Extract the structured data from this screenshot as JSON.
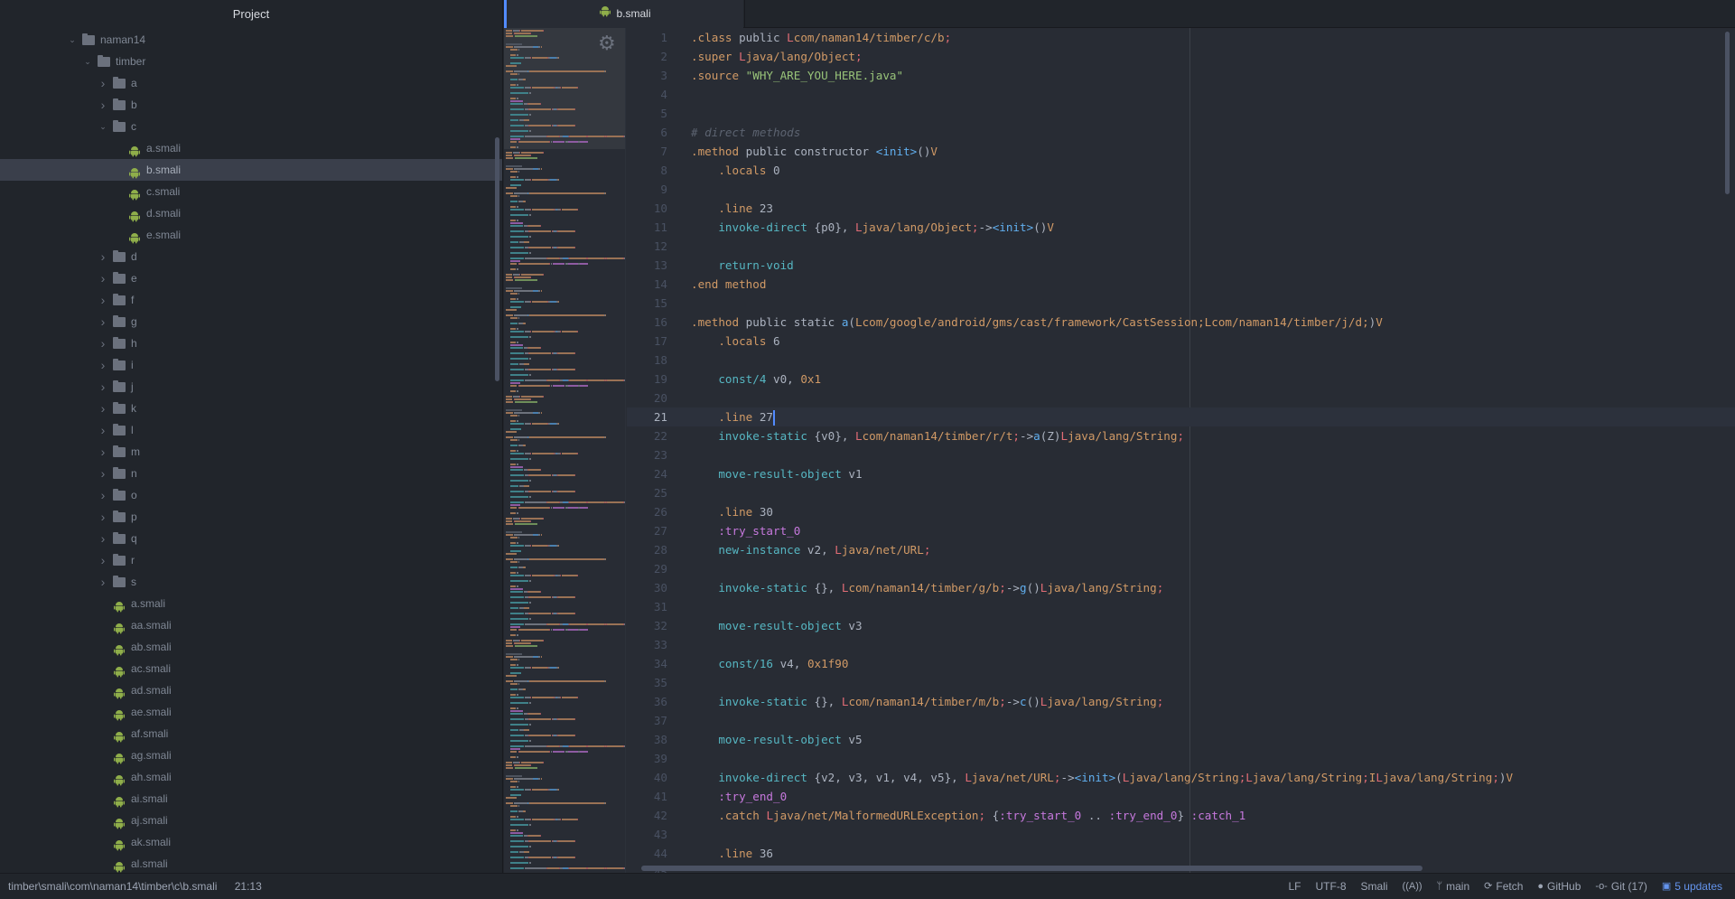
{
  "tree": {
    "header": "Project",
    "selected_file": "b.smali",
    "items": [
      {
        "label": "naman14",
        "type": "folder",
        "expanded": true,
        "depth": 0
      },
      {
        "label": "timber",
        "type": "folder",
        "expanded": true,
        "depth": 1
      },
      {
        "label": "a",
        "type": "folder",
        "expanded": false,
        "depth": 2
      },
      {
        "label": "b",
        "type": "folder",
        "expanded": false,
        "depth": 2
      },
      {
        "label": "c",
        "type": "folder",
        "expanded": true,
        "depth": 2
      },
      {
        "label": "a.smali",
        "type": "file",
        "depth": 3
      },
      {
        "label": "b.smali",
        "type": "file",
        "depth": 3,
        "selected": true
      },
      {
        "label": "c.smali",
        "type": "file",
        "depth": 3
      },
      {
        "label": "d.smali",
        "type": "file",
        "depth": 3
      },
      {
        "label": "e.smali",
        "type": "file",
        "depth": 3
      },
      {
        "label": "d",
        "type": "folder",
        "expanded": false,
        "depth": 2
      },
      {
        "label": "e",
        "type": "folder",
        "expanded": false,
        "depth": 2
      },
      {
        "label": "f",
        "type": "folder",
        "expanded": false,
        "depth": 2
      },
      {
        "label": "g",
        "type": "folder",
        "expanded": false,
        "depth": 2
      },
      {
        "label": "h",
        "type": "folder",
        "expanded": false,
        "depth": 2
      },
      {
        "label": "i",
        "type": "folder",
        "expanded": false,
        "depth": 2
      },
      {
        "label": "j",
        "type": "folder",
        "expanded": false,
        "depth": 2
      },
      {
        "label": "k",
        "type": "folder",
        "expanded": false,
        "depth": 2
      },
      {
        "label": "l",
        "type": "folder",
        "expanded": false,
        "depth": 2
      },
      {
        "label": "m",
        "type": "folder",
        "expanded": false,
        "depth": 2
      },
      {
        "label": "n",
        "type": "folder",
        "expanded": false,
        "depth": 2
      },
      {
        "label": "o",
        "type": "folder",
        "expanded": false,
        "depth": 2
      },
      {
        "label": "p",
        "type": "folder",
        "expanded": false,
        "depth": 2
      },
      {
        "label": "q",
        "type": "folder",
        "expanded": false,
        "depth": 2
      },
      {
        "label": "r",
        "type": "folder",
        "expanded": false,
        "depth": 2
      },
      {
        "label": "s",
        "type": "folder",
        "expanded": false,
        "depth": 2
      },
      {
        "label": "a.smali",
        "type": "file",
        "depth": 2
      },
      {
        "label": "aa.smali",
        "type": "file",
        "depth": 2
      },
      {
        "label": "ab.smali",
        "type": "file",
        "depth": 2
      },
      {
        "label": "ac.smali",
        "type": "file",
        "depth": 2
      },
      {
        "label": "ad.smali",
        "type": "file",
        "depth": 2
      },
      {
        "label": "ae.smali",
        "type": "file",
        "depth": 2
      },
      {
        "label": "af.smali",
        "type": "file",
        "depth": 2
      },
      {
        "label": "ag.smali",
        "type": "file",
        "depth": 2
      },
      {
        "label": "ah.smali",
        "type": "file",
        "depth": 2
      },
      {
        "label": "ai.smali",
        "type": "file",
        "depth": 2
      },
      {
        "label": "aj.smali",
        "type": "file",
        "depth": 2
      },
      {
        "label": "ak.smali",
        "type": "file",
        "depth": 2
      },
      {
        "label": "al.smali",
        "type": "file",
        "depth": 2
      }
    ]
  },
  "editor": {
    "tab": {
      "label": "b.smali",
      "icon": "android-icon"
    },
    "cursor_line": 21,
    "lines": [
      [
        [
          "kw",
          ".class"
        ],
        [
          "pl",
          " public "
        ],
        [
          "L",
          "L"
        ],
        [
          "ty",
          "com/naman14/timber/c/b"
        ],
        [
          "sep",
          ";"
        ]
      ],
      [
        [
          "kw",
          ".super"
        ],
        [
          "pl",
          " "
        ],
        [
          "L",
          "L"
        ],
        [
          "ty",
          "java/lang/Object"
        ],
        [
          "sep",
          ";"
        ]
      ],
      [
        [
          "kw",
          ".source"
        ],
        [
          "pl",
          " "
        ],
        [
          "str",
          "\"WHY_ARE_YOU_HERE.java\""
        ]
      ],
      [],
      [],
      [
        [
          "cm",
          "# direct methods"
        ]
      ],
      [
        [
          "kw",
          ".method"
        ],
        [
          "pl",
          " public constructor "
        ],
        [
          "fn",
          "<init>"
        ],
        [
          "pl",
          "()"
        ],
        [
          "ty",
          "V"
        ]
      ],
      [
        [
          "pl",
          "    "
        ],
        [
          "kw",
          ".locals"
        ],
        [
          "pl",
          " 0"
        ]
      ],
      [],
      [
        [
          "pl",
          "    "
        ],
        [
          "kw",
          ".line"
        ],
        [
          "pl",
          " 23"
        ]
      ],
      [
        [
          "pl",
          "    "
        ],
        [
          "ins",
          "invoke-direct"
        ],
        [
          "pl",
          " {p0}, "
        ],
        [
          "L",
          "L"
        ],
        [
          "ty",
          "java/lang/Object"
        ],
        [
          "sep",
          ";"
        ],
        [
          "pl",
          "->"
        ],
        [
          "fn",
          "<init>"
        ],
        [
          "pl",
          "()"
        ],
        [
          "ty",
          "V"
        ]
      ],
      [],
      [
        [
          "pl",
          "    "
        ],
        [
          "ins",
          "return-void"
        ]
      ],
      [
        [
          "kw",
          ".end method"
        ]
      ],
      [],
      [
        [
          "kw",
          ".method"
        ],
        [
          "pl",
          " public static "
        ],
        [
          "fn",
          "a"
        ],
        [
          "pl",
          "("
        ],
        [
          "ty",
          "Lcom/google/android/gms/cast/framework/CastSession;Lcom/naman14/timber/j/d;"
        ],
        [
          "pl",
          ")"
        ],
        [
          "ty",
          "V"
        ]
      ],
      [
        [
          "pl",
          "    "
        ],
        [
          "kw",
          ".locals"
        ],
        [
          "pl",
          " 6"
        ]
      ],
      [],
      [
        [
          "pl",
          "    "
        ],
        [
          "ins",
          "const/4"
        ],
        [
          "pl",
          " v0, "
        ],
        [
          "num",
          "0x1"
        ]
      ],
      [],
      [
        [
          "pl",
          "    "
        ],
        [
          "kw",
          ".line"
        ],
        [
          "pl",
          " 27"
        ],
        [
          "caret",
          ""
        ]
      ],
      [
        [
          "pl",
          "    "
        ],
        [
          "ins",
          "invoke-static"
        ],
        [
          "pl",
          " {v0}, "
        ],
        [
          "L",
          "L"
        ],
        [
          "ty",
          "com/naman14/timber/r/t"
        ],
        [
          "sep",
          ";"
        ],
        [
          "pl",
          "->"
        ],
        [
          "fn",
          "a"
        ],
        [
          "pl",
          "(Z)"
        ],
        [
          "L",
          "L"
        ],
        [
          "ty",
          "java/lang/String"
        ],
        [
          "sep",
          ";"
        ]
      ],
      [],
      [
        [
          "pl",
          "    "
        ],
        [
          "ins",
          "move-result-object"
        ],
        [
          "pl",
          " v1"
        ]
      ],
      [],
      [
        [
          "pl",
          "    "
        ],
        [
          "kw",
          ".line"
        ],
        [
          "pl",
          " 30"
        ]
      ],
      [
        [
          "pl",
          "    "
        ],
        [
          "lbl",
          ":try_start_0"
        ]
      ],
      [
        [
          "pl",
          "    "
        ],
        [
          "ins",
          "new-instance"
        ],
        [
          "pl",
          " v2, "
        ],
        [
          "L",
          "L"
        ],
        [
          "ty",
          "java/net/URL"
        ],
        [
          "sep",
          ";"
        ]
      ],
      [],
      [
        [
          "pl",
          "    "
        ],
        [
          "ins",
          "invoke-static"
        ],
        [
          "pl",
          " {}, "
        ],
        [
          "L",
          "L"
        ],
        [
          "ty",
          "com/naman14/timber/g/b"
        ],
        [
          "sep",
          ";"
        ],
        [
          "pl",
          "->"
        ],
        [
          "fn",
          "g"
        ],
        [
          "pl",
          "()"
        ],
        [
          "L",
          "L"
        ],
        [
          "ty",
          "java/lang/String"
        ],
        [
          "sep",
          ";"
        ]
      ],
      [],
      [
        [
          "pl",
          "    "
        ],
        [
          "ins",
          "move-result-object"
        ],
        [
          "pl",
          " v3"
        ]
      ],
      [],
      [
        [
          "pl",
          "    "
        ],
        [
          "ins",
          "const/16"
        ],
        [
          "pl",
          " v4, "
        ],
        [
          "num",
          "0x1f90"
        ]
      ],
      [],
      [
        [
          "pl",
          "    "
        ],
        [
          "ins",
          "invoke-static"
        ],
        [
          "pl",
          " {}, "
        ],
        [
          "L",
          "L"
        ],
        [
          "ty",
          "com/naman14/timber/m/b"
        ],
        [
          "sep",
          ";"
        ],
        [
          "pl",
          "->"
        ],
        [
          "fn",
          "c"
        ],
        [
          "pl",
          "()"
        ],
        [
          "L",
          "L"
        ],
        [
          "ty",
          "java/lang/String"
        ],
        [
          "sep",
          ";"
        ]
      ],
      [],
      [
        [
          "pl",
          "    "
        ],
        [
          "ins",
          "move-result-object"
        ],
        [
          "pl",
          " v5"
        ]
      ],
      [],
      [
        [
          "pl",
          "    "
        ],
        [
          "ins",
          "invoke-direct"
        ],
        [
          "pl",
          " {v2, v3, v1, v4, v5}, "
        ],
        [
          "L",
          "L"
        ],
        [
          "ty",
          "java/net/URL"
        ],
        [
          "sep",
          ";"
        ],
        [
          "pl",
          "->"
        ],
        [
          "fn",
          "<init>"
        ],
        [
          "pl",
          "("
        ],
        [
          "L",
          "L"
        ],
        [
          "ty",
          "java/lang/String"
        ],
        [
          "sep",
          ";"
        ],
        [
          "L",
          "L"
        ],
        [
          "ty",
          "java/lang/String"
        ],
        [
          "sep",
          ";"
        ],
        [
          "ty",
          "I"
        ],
        [
          "L",
          "L"
        ],
        [
          "ty",
          "java/lang/String"
        ],
        [
          "sep",
          ";"
        ],
        [
          "pl",
          ")"
        ],
        [
          "ty",
          "V"
        ]
      ],
      [
        [
          "pl",
          "    "
        ],
        [
          "lbl",
          ":try_end_0"
        ]
      ],
      [
        [
          "pl",
          "    "
        ],
        [
          "kw",
          ".catch"
        ],
        [
          "pl",
          " "
        ],
        [
          "L",
          "L"
        ],
        [
          "ty",
          "java/net/MalformedURLException"
        ],
        [
          "sep",
          ";"
        ],
        [
          "pl",
          " {"
        ],
        [
          "lbl",
          ":try_start_0"
        ],
        [
          "pl",
          " .. "
        ],
        [
          "lbl",
          ":try_end_0"
        ],
        [
          "pl",
          "} "
        ],
        [
          "lbl",
          ":catch_1"
        ]
      ],
      [],
      [
        [
          "pl",
          "    "
        ],
        [
          "kw",
          ".line"
        ],
        [
          "pl",
          " 36"
        ]
      ],
      []
    ]
  },
  "status_bar": {
    "file_path": "timber\\smali\\com\\naman14\\timber\\c\\b.smali",
    "cursor_position": "21:13",
    "line_ending": "LF",
    "encoding": "UTF-8",
    "grammar": "Smali",
    "branch": "main",
    "fetch": "Fetch",
    "github": "GitHub",
    "git": "Git (17)",
    "updates": "5 updates"
  },
  "colors": {
    "accent": "#528bff",
    "android_green": "#8fae4a",
    "updates_blue": "#6494ed"
  }
}
